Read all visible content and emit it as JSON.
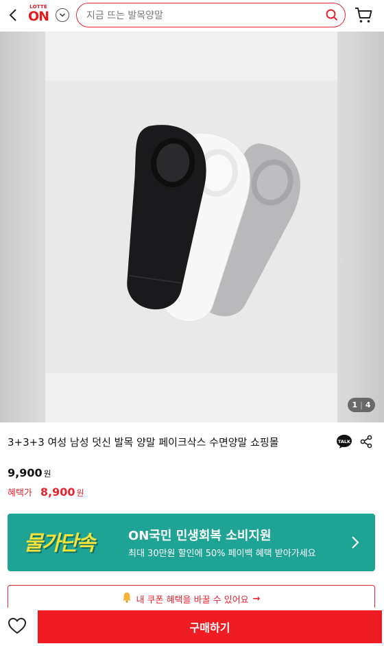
{
  "header": {
    "logo_top": "LOTTE",
    "logo_main": "ON",
    "search_placeholder": "지금 뜨는 발목양말"
  },
  "gallery": {
    "current": "1",
    "separator": "|",
    "total": "4"
  },
  "product": {
    "title": "3+3+3 여성 남성 덧신 발목 양말 페이크삭스 수면양말 쇼핑몰",
    "talk_badge": "TALK",
    "price": "9,900",
    "price_unit": "원",
    "benefit_label": "혜택가",
    "benefit_price": "8,900",
    "benefit_unit": "원"
  },
  "banner": {
    "logo_text": "물가단속",
    "title": "ON국민 민생회복 소비지원",
    "subtitle": "최대 30만원 할인에 50% 페이백 혜택 받아가세요"
  },
  "coupon": {
    "label": "내 쿠폰 혜택을 바꿀 수 있어요",
    "arrow": "→"
  },
  "bottom_bar": {
    "buy_label": "구매하기"
  },
  "colors": {
    "brand_red": "#e8242f",
    "banner_teal": "#1fa395",
    "banner_yellow": "#f4e33b"
  }
}
